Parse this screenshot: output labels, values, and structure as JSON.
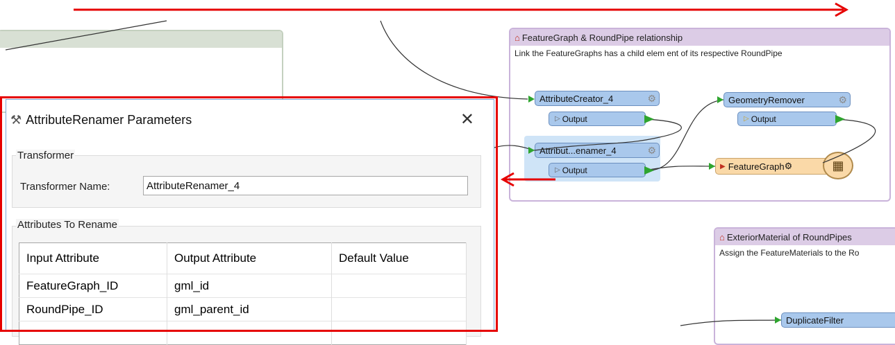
{
  "canvas": {
    "bookmark_featuregraph": {
      "title": "FeatureGraph & RoundPipe relationship",
      "description": "Link the FeatureGraphs has a child elem ent of its respective RoundPipe"
    },
    "bookmark_exterior": {
      "title": "ExteriorMaterial of RoundPipes",
      "description": "Assign the FeatureMaterials to the Ro"
    },
    "transformers": {
      "attribute_creator": "AttributeCreator_4",
      "geometry_remover": "GeometryRemover",
      "attribute_renamer": "Attribut...enamer_4",
      "duplicate_filter": "DuplicateFilter"
    },
    "ports": {
      "output_label": "Output"
    },
    "writer": {
      "label": "FeatureGraph"
    }
  },
  "dialog": {
    "title": "AttributeRenamer Parameters",
    "close_glyph": "✕",
    "transformer_group_label": "Transformer",
    "transformer_name_label": "Transformer Name:",
    "transformer_name_value": "AttributeRenamer_4",
    "attributes_group_label": "Attributes To Rename",
    "table": {
      "headers": [
        "Input Attribute",
        "Output Attribute",
        "Default Value"
      ],
      "rows": [
        [
          "FeatureGraph_ID",
          "gml_id",
          ""
        ],
        [
          "RoundPipe_ID",
          "gml_parent_id",
          ""
        ],
        [
          "",
          "",
          ""
        ]
      ]
    }
  },
  "icons": {
    "bookmark": "bookmark-icon",
    "gear": "gear-icon",
    "table_writer": "table-icon",
    "dialog": "transformer-icon"
  },
  "colors": {
    "annotation_red": "#e60000",
    "transformer_blue": "#a9c8ec",
    "writer_orange": "#fad9a8",
    "bookmark_purple": "#dccce6",
    "connector_green": "#2fa52f"
  }
}
